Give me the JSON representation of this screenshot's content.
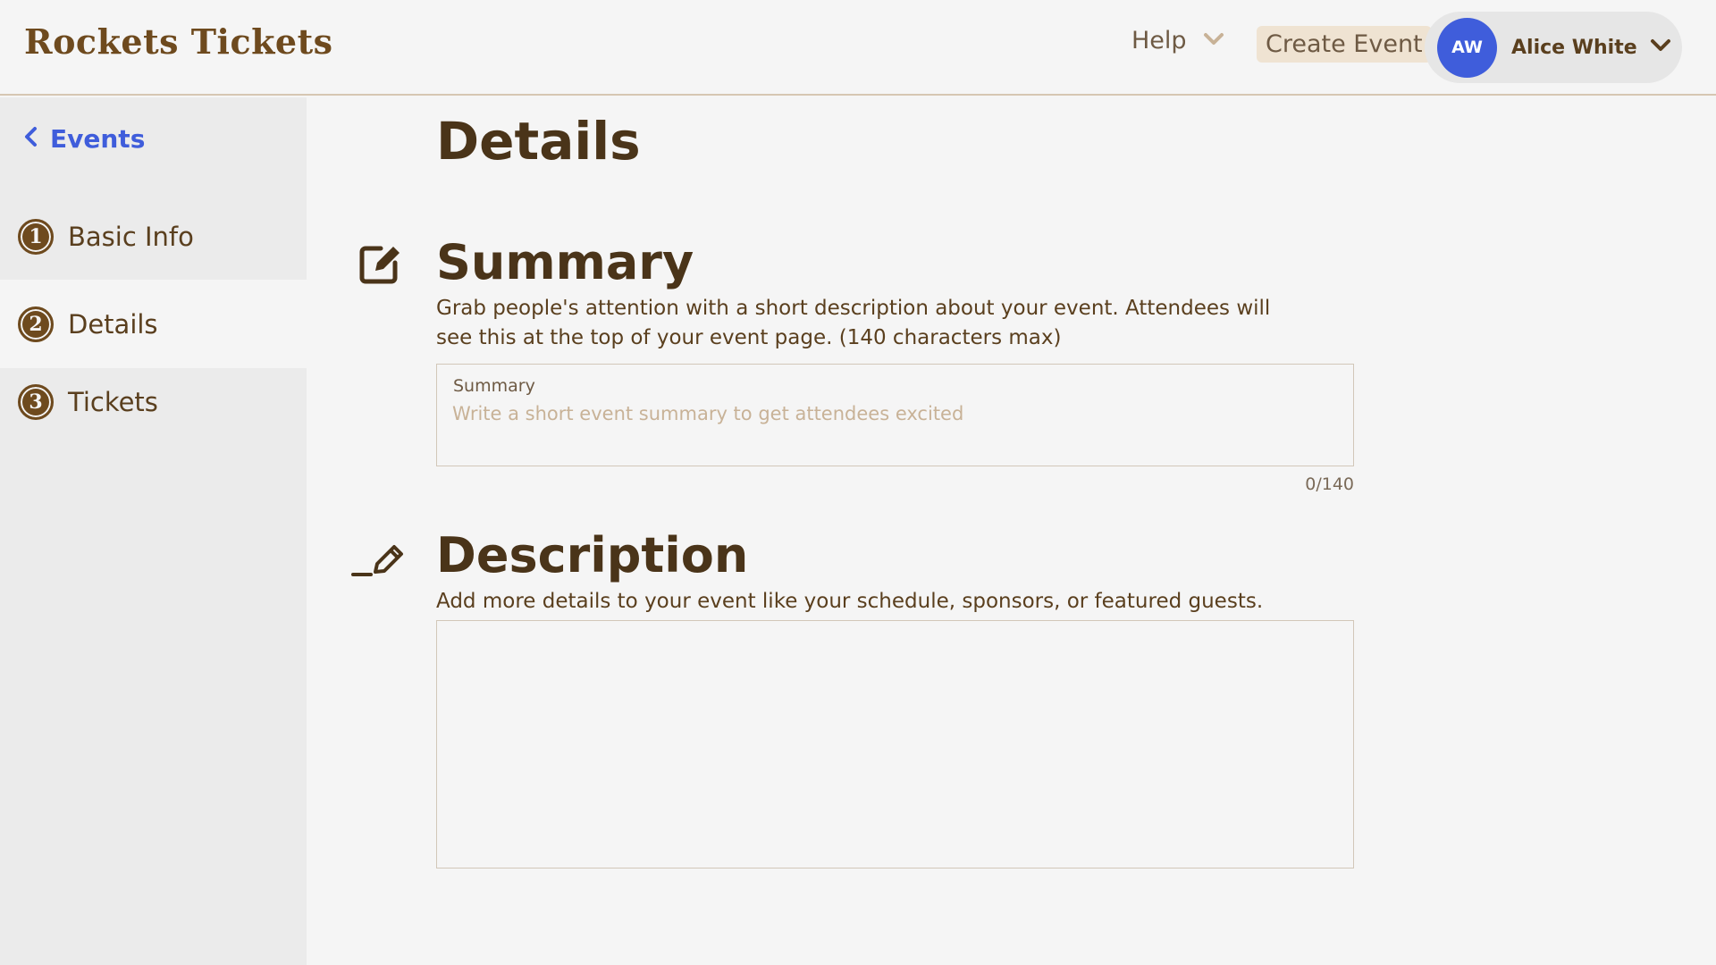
{
  "header": {
    "brand": "Rockets Tickets",
    "help_label": "Help",
    "create_event_label": "Create Event",
    "user": {
      "initials": "AW",
      "name": "Alice White"
    }
  },
  "colors": {
    "brand_brown": "#6e4a1e",
    "accent_blue": "#3f5ddb",
    "background": "#f5f5f5",
    "sidebar_bg": "#ebebeb"
  },
  "sidebar": {
    "back_label": "Events",
    "steps": [
      {
        "number": "1",
        "label": "Basic Info",
        "active": false
      },
      {
        "number": "2",
        "label": "Details",
        "active": true
      },
      {
        "number": "3",
        "label": "Tickets",
        "active": false
      }
    ]
  },
  "main": {
    "title": "Details",
    "summary": {
      "icon": "edit-square-icon",
      "title": "Summary",
      "description": "Grab people's attention with a short description about your event. Attendees will see this at the top of your event page. (140 characters max)",
      "field_label": "Summary",
      "placeholder": "Write a short event summary to get attendees excited",
      "value": "",
      "counter": "0/140"
    },
    "description": {
      "icon": "pencil-icon",
      "title": "Description",
      "description": "Add more details to your event like your schedule, sponsors, or featured guests.",
      "value": ""
    }
  }
}
